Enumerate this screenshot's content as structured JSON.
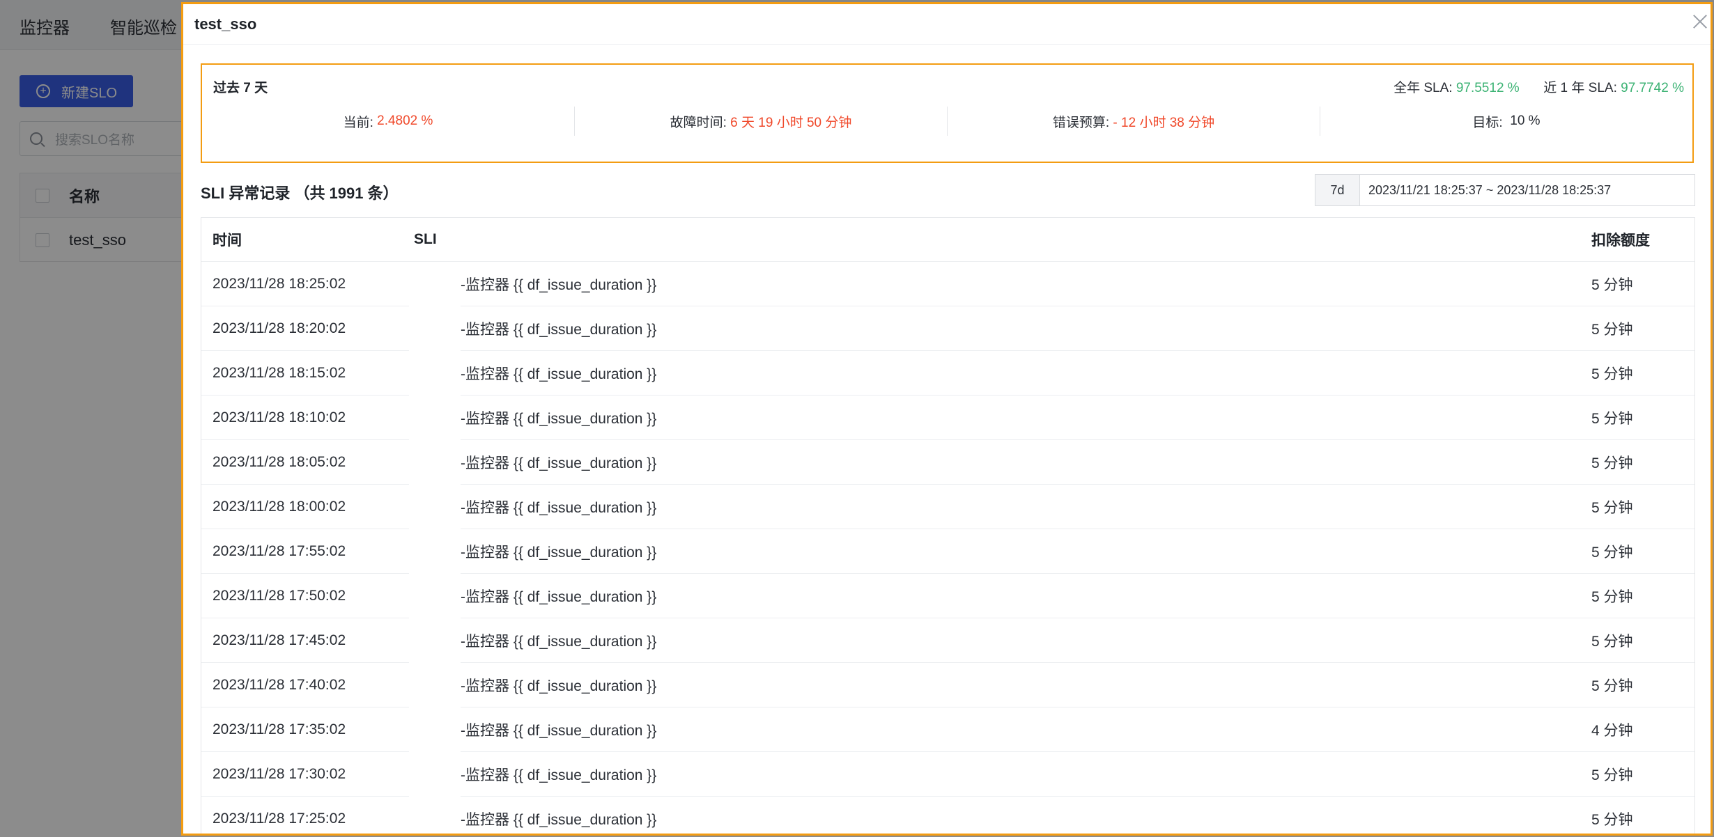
{
  "background": {
    "nav": [
      "监控器",
      "智能巡检"
    ],
    "new_button": "新建SLO",
    "search_placeholder": "搜索SLO名称",
    "table_header": "名称",
    "table_row": "test_sso"
  },
  "drawer": {
    "title": "test_sso",
    "sla": {
      "period": "过去 7 天",
      "year_label": "全年 SLA:",
      "year_value": "97.5512 %",
      "last_year_label": "近 1 年 SLA:",
      "last_year_value": "97.7742 %",
      "metrics": [
        {
          "label": "当前:",
          "value": "2.4802 %",
          "color": "#f0492b"
        },
        {
          "label": "故障时间:",
          "value": "6 天 19 小时 50 分钟",
          "color": "#f0492b"
        },
        {
          "label": "错误预算:",
          "value": "- 12 小时 38 分钟",
          "color": "#f0492b"
        },
        {
          "label": "目标:",
          "value": "10 %",
          "color": "#2b2f36"
        }
      ]
    },
    "sli_title": "SLI 异常记录 （共 1991 条）",
    "range": {
      "preset": "7d",
      "text": "2023/11/21 18:25:37 ~ 2023/11/28 18:25:37"
    },
    "table": {
      "headers": [
        "时间",
        "SLI",
        "扣除额度"
      ],
      "rows": [
        {
          "time": "2023/11/28 18:25:02",
          "sli": "-监控器 {{ df_issue_duration }}",
          "deduction": "5 分钟"
        },
        {
          "time": "2023/11/28 18:20:02",
          "sli": "-监控器 {{ df_issue_duration }}",
          "deduction": "5 分钟"
        },
        {
          "time": "2023/11/28 18:15:02",
          "sli": "-监控器 {{ df_issue_duration }}",
          "deduction": "5 分钟"
        },
        {
          "time": "2023/11/28 18:10:02",
          "sli": "-监控器 {{ df_issue_duration }}",
          "deduction": "5 分钟"
        },
        {
          "time": "2023/11/28 18:05:02",
          "sli": "-监控器 {{ df_issue_duration }}",
          "deduction": "5 分钟"
        },
        {
          "time": "2023/11/28 18:00:02",
          "sli": "-监控器 {{ df_issue_duration }}",
          "deduction": "5 分钟"
        },
        {
          "time": "2023/11/28 17:55:02",
          "sli": "-监控器 {{ df_issue_duration }}",
          "deduction": "5 分钟"
        },
        {
          "time": "2023/11/28 17:50:02",
          "sli": "-监控器 {{ df_issue_duration }}",
          "deduction": "5 分钟"
        },
        {
          "time": "2023/11/28 17:45:02",
          "sli": "-监控器 {{ df_issue_duration }}",
          "deduction": "5 分钟"
        },
        {
          "time": "2023/11/28 17:40:02",
          "sli": "-监控器 {{ df_issue_duration }}",
          "deduction": "5 分钟"
        },
        {
          "time": "2023/11/28 17:35:02",
          "sli": "-监控器 {{ df_issue_duration }}",
          "deduction": "4 分钟"
        },
        {
          "time": "2023/11/28 17:30:02",
          "sli": "-监控器 {{ df_issue_duration }}",
          "deduction": "5 分钟"
        },
        {
          "time": "2023/11/28 17:25:02",
          "sli": "-监控器 {{ df_issue_duration }}",
          "deduction": "5 分钟"
        }
      ]
    }
  },
  "colors": {
    "accent": "#3a5de6",
    "danger": "#f0492b",
    "success": "#3bb273",
    "highlight_border": "#f39c12"
  }
}
